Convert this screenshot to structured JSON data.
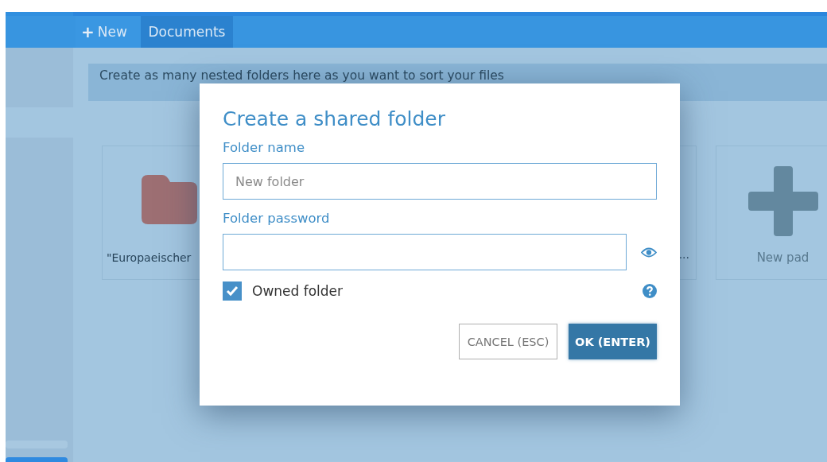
{
  "toolbar": {
    "new_button": {
      "icon": "+",
      "label": "New"
    },
    "breadcrumbs": [
      {
        "label": "Documents",
        "selected": true
      }
    ]
  },
  "info_bar": {
    "text": "Create as many nested folders here as you want to sort your files"
  },
  "cards": [
    {
      "kind": "folder",
      "label": "\"Europaeischer"
    },
    {
      "kind": "folder-tail",
      "label": "..."
    },
    {
      "kind": "new",
      "label": "New pad"
    }
  ],
  "dialog": {
    "title": "Create a shared folder",
    "fields": [
      {
        "label": "Folder name",
        "placeholder": "New folder",
        "kind": "text"
      },
      {
        "label": "Folder password",
        "kind": "password"
      }
    ],
    "owned": {
      "label": "Owned folder",
      "checked": true
    },
    "buttons": [
      {
        "label": "CANCEL (ESC)",
        "kind": "secondary"
      },
      {
        "label": "OK (ENTER)",
        "kind": "primary"
      }
    ]
  }
}
